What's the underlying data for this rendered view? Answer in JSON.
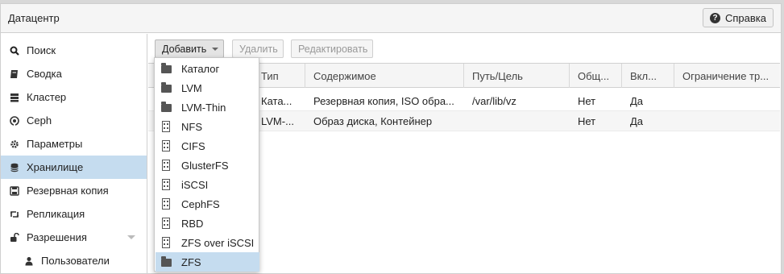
{
  "header": {
    "title": "Датацентр",
    "help_label": "Справка"
  },
  "sidebar": {
    "items": [
      {
        "label": "Поиск",
        "icon": "search-icon"
      },
      {
        "label": "Сводка",
        "icon": "book-icon"
      },
      {
        "label": "Кластер",
        "icon": "server-icon"
      },
      {
        "label": "Ceph",
        "icon": "ceph-icon"
      },
      {
        "label": "Параметры",
        "icon": "gear-icon"
      },
      {
        "label": "Хранилище",
        "icon": "database-icon",
        "active": true
      },
      {
        "label": "Резервная копия",
        "icon": "floppy-icon"
      },
      {
        "label": "Репликация",
        "icon": "retweet-icon"
      },
      {
        "label": "Разрешения",
        "icon": "unlock-icon",
        "expandable": true
      },
      {
        "label": "Пользователи",
        "icon": "user-icon",
        "sub": true
      }
    ]
  },
  "toolbar": {
    "add_label": "Добавить",
    "remove_label": "Удалить",
    "edit_label": "Редактировать"
  },
  "table": {
    "columns": [
      "Тип",
      "Содержимое",
      "Путь/Цель",
      "Общ...",
      "Вкл...",
      "Ограничение тр..."
    ],
    "rows": [
      [
        "Ката...",
        "Резервная копия, ISO обра...",
        "/var/lib/vz",
        "Нет",
        "Да",
        ""
      ],
      [
        "LVM-...",
        "Образ диска, Контейнер",
        "",
        "Нет",
        "Да",
        ""
      ]
    ]
  },
  "add_menu": {
    "items": [
      {
        "label": "Каталог",
        "icon": "folder-icon"
      },
      {
        "label": "LVM",
        "icon": "folder-icon"
      },
      {
        "label": "LVM-Thin",
        "icon": "folder-icon"
      },
      {
        "label": "NFS",
        "icon": "building-icon"
      },
      {
        "label": "CIFS",
        "icon": "building-icon"
      },
      {
        "label": "GlusterFS",
        "icon": "building-icon"
      },
      {
        "label": "iSCSI",
        "icon": "building-icon"
      },
      {
        "label": "CephFS",
        "icon": "building-icon"
      },
      {
        "label": "RBD",
        "icon": "building-icon"
      },
      {
        "label": "ZFS over iSCSI",
        "icon": "building-icon"
      },
      {
        "label": "ZFS",
        "icon": "folder-icon",
        "highlighted": true
      }
    ]
  },
  "colors": {
    "selection": "#c5dcef",
    "header_bg": "#f5f5f5",
    "border": "#d0d0d0"
  }
}
